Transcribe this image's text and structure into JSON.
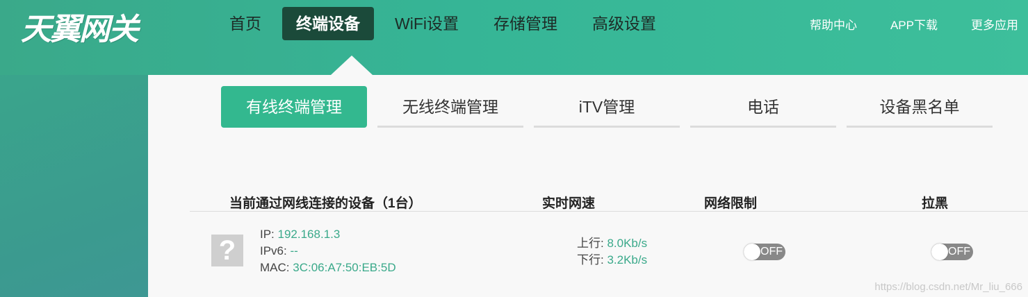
{
  "logo": "天翼网关",
  "nav": [
    "首页",
    "终端设备",
    "WiFi设置",
    "存储管理",
    "高级设置"
  ],
  "right_links": [
    "帮助中心",
    "APP下载",
    "更多应用"
  ],
  "subtabs": [
    "有线终端管理",
    "无线终端管理",
    "iTV管理",
    "电话",
    "设备黑名单"
  ],
  "table": {
    "headers": [
      "当前通过网线连接的设备（1台）",
      "实时网速",
      "网络限制",
      "拉黑"
    ],
    "device": {
      "icon": "?",
      "ip_label": "IP: ",
      "ip": "192.168.1.3",
      "ipv6_label": "IPv6: ",
      "ipv6": "--",
      "mac_label": "MAC: ",
      "mac": "3C:06:A7:50:EB:5D",
      "up_label": "上行: ",
      "up": "8.0Kb/s",
      "down_label": "下行: ",
      "down": "3.2Kb/s",
      "limit_toggle": "OFF",
      "block_toggle": "OFF"
    }
  },
  "watermark": "https://blog.csdn.net/Mr_liu_666"
}
